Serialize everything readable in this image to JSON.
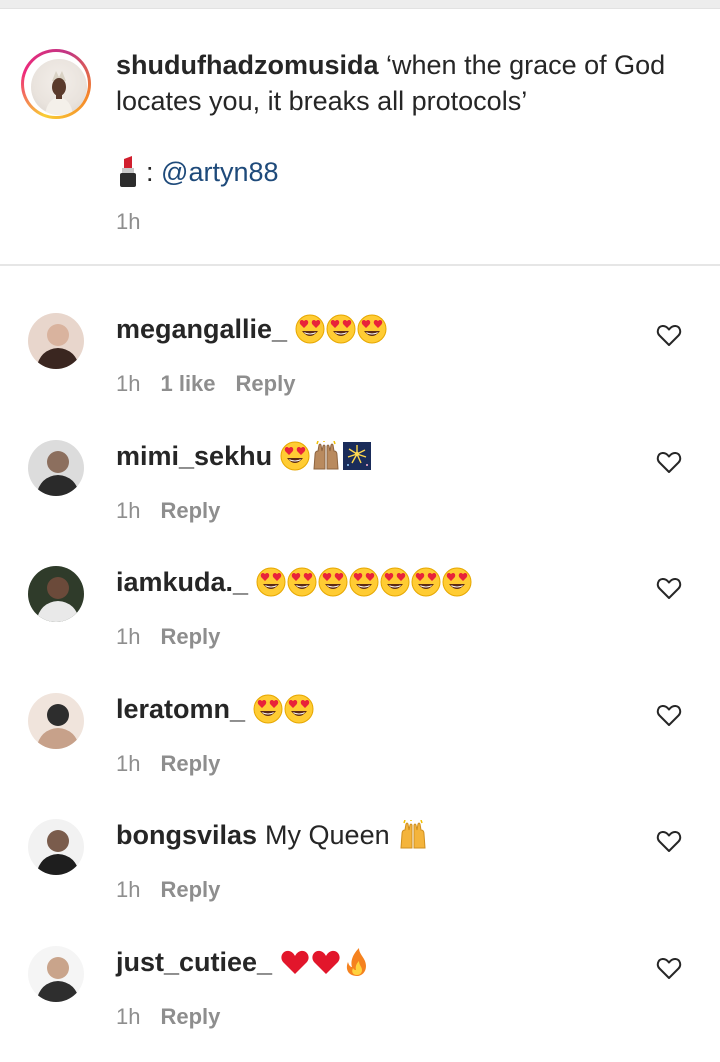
{
  "caption": {
    "username": "shudufhadzomusida",
    "text": "‘when the grace of God locates you, it breaks all protocols’",
    "mention_prefix": ":",
    "mention": "@artyn88",
    "time": "1h"
  },
  "comments": [
    {
      "username": "megangallie_",
      "text": "",
      "emojis": [
        "heart-eyes",
        "heart-eyes",
        "heart-eyes"
      ],
      "time": "1h",
      "likes": "1 like",
      "reply": "Reply"
    },
    {
      "username": "mimi_sekhu",
      "text": "",
      "emojis": [
        "heart-eyes",
        "raised-hands-medium",
        "fireworks"
      ],
      "time": "1h",
      "likes": "",
      "reply": "Reply"
    },
    {
      "username": "iamkuda._",
      "text": "",
      "emojis": [
        "heart-eyes",
        "heart-eyes",
        "heart-eyes",
        "heart-eyes",
        "heart-eyes",
        "heart-eyes",
        "heart-eyes"
      ],
      "time": "1h",
      "likes": "",
      "reply": "Reply"
    },
    {
      "username": "leratomn_",
      "text": "",
      "emojis": [
        "heart-eyes",
        "heart-eyes"
      ],
      "time": "1h",
      "likes": "",
      "reply": "Reply"
    },
    {
      "username": "bongsvilas",
      "text": "My Queen",
      "emojis": [
        "raised-hands"
      ],
      "time": "1h",
      "likes": "",
      "reply": "Reply"
    },
    {
      "username": "just_cutiee_",
      "text": "",
      "emojis": [
        "red-heart",
        "red-heart",
        "fire"
      ],
      "time": "1h",
      "likes": "",
      "reply": "Reply"
    }
  ],
  "colors": {
    "text": "#262626",
    "meta": "#8e8e8e",
    "mention": "#1e4a7a",
    "divider": "#e6e6e6"
  },
  "icons": [
    "lipstick-icon",
    "heart-outline-icon"
  ]
}
